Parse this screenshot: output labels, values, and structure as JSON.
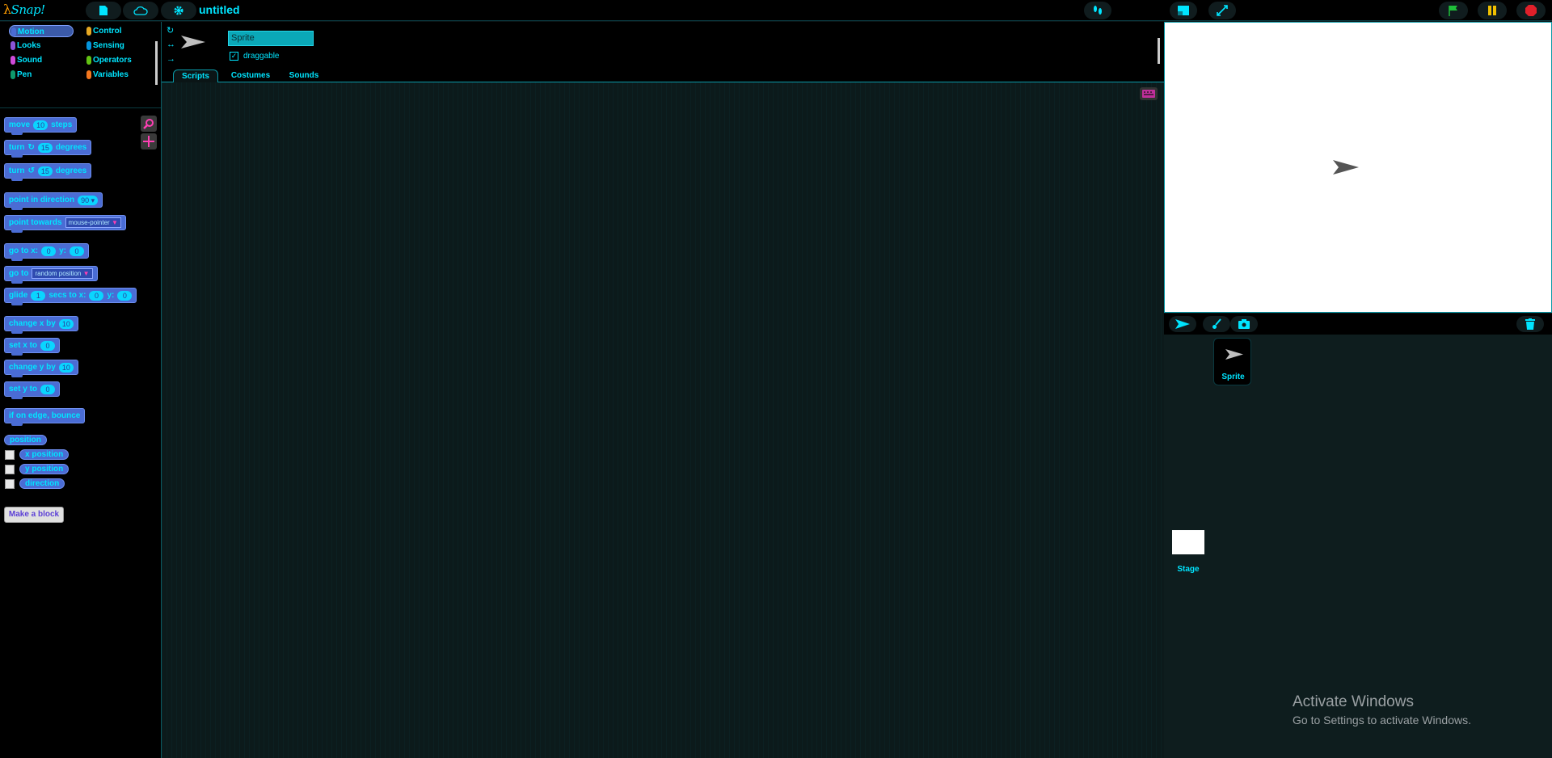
{
  "app": {
    "logo_text": "Snap!",
    "project_title": "untitled"
  },
  "topbar": {
    "icons": [
      "file-icon",
      "cloud-icon",
      "gear-icon",
      "footsteps-icon",
      "stage-size-icon",
      "fullscreen-icon",
      "green-flag-icon",
      "pause-icon",
      "stop-icon"
    ]
  },
  "categories": [
    {
      "label": "Motion",
      "color": "#4a6cd4",
      "active": true
    },
    {
      "label": "Control",
      "color": "#e6a822"
    },
    {
      "label": "Looks",
      "color": "#8a55d7"
    },
    {
      "label": "Sensing",
      "color": "#0494dc"
    },
    {
      "label": "Sound",
      "color": "#cf4ad9"
    },
    {
      "label": "Operators",
      "color": "#62c213"
    },
    {
      "label": "Pen",
      "color": "#0e9a6c"
    },
    {
      "label": "Variables",
      "color": "#f3761d"
    }
  ],
  "blocks": {
    "move": {
      "a": "move",
      "v": "10",
      "b": "steps"
    },
    "turn_cw": {
      "a": "turn",
      "v": "15",
      "b": "degrees"
    },
    "turn_ccw": {
      "a": "turn",
      "v": "15",
      "b": "degrees"
    },
    "point_dir": {
      "a": "point in direction",
      "v": "90"
    },
    "point_towards": {
      "a": "point towards",
      "v": "mouse-pointer"
    },
    "goto_xy": {
      "a": "go to x:",
      "x": "0",
      "b": "y:",
      "y": "0"
    },
    "goto": {
      "a": "go to",
      "v": "random position"
    },
    "glide": {
      "a": "glide",
      "s": "1",
      "b": "secs to x:",
      "x": "0",
      "c": "y:",
      "y": "0"
    },
    "change_x": {
      "a": "change x by",
      "v": "10"
    },
    "set_x": {
      "a": "set x to",
      "v": "0"
    },
    "change_y": {
      "a": "change y by",
      "v": "10"
    },
    "set_y": {
      "a": "set y to",
      "v": "0"
    },
    "bounce": {
      "a": "if on edge, bounce"
    },
    "position": "position",
    "x_position": "x position",
    "y_position": "y position",
    "direction": "direction",
    "make_block": "Make a block"
  },
  "sprite": {
    "name": "Sprite",
    "draggable_label": "draggable",
    "draggable_checked": "✓"
  },
  "tabs": [
    "Scripts",
    "Costumes",
    "Sounds"
  ],
  "corral": {
    "sprite_label": "Sprite",
    "stage_label": "Stage"
  },
  "watermark": {
    "title": "Activate Windows",
    "subtitle": "Go to Settings to activate Windows."
  }
}
